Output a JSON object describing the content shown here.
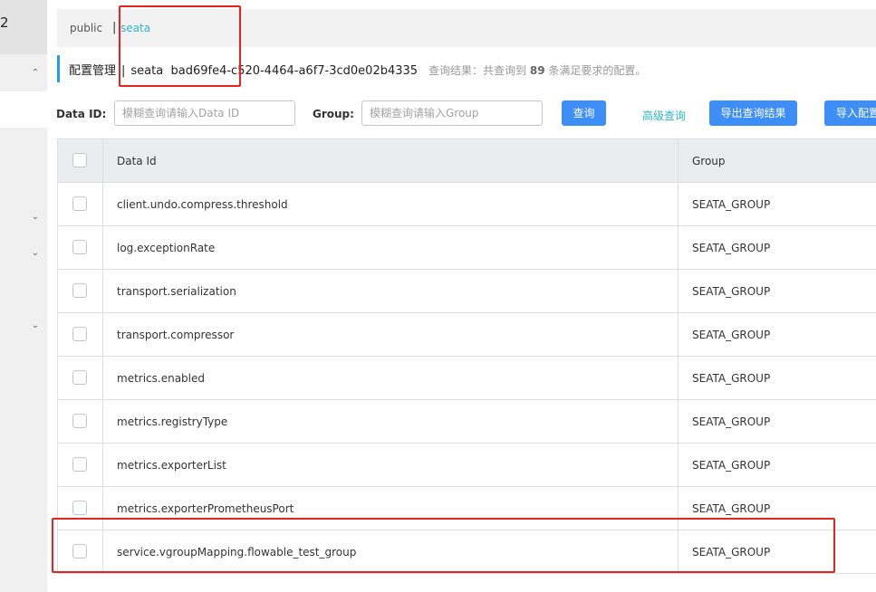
{
  "sidebar": {
    "top_label": "2",
    "icons": [
      "chevron-up-icon",
      "chevron-down-icon",
      "chevron-down-icon",
      "chevron-down-icon"
    ]
  },
  "namespaces": {
    "items": [
      "public",
      "seata"
    ],
    "separator": "|",
    "active": "seata"
  },
  "header": {
    "title": "配置管理",
    "separator": "|",
    "namespace": "seata",
    "namespace_id": "bad69fe4-c520-4464-a6f7-3cd0e02b4335",
    "result_prefix": "查询结果：共查询到",
    "result_count": "89",
    "result_suffix": "条满足要求的配置。"
  },
  "search": {
    "data_id_label": "Data ID:",
    "data_id_placeholder": "模糊查询请输入Data ID",
    "group_label": "Group:",
    "group_placeholder": "模糊查询请输入Group",
    "query_button": "查询",
    "advanced_link": "高级查询",
    "export_button": "导出查询结果",
    "import_button": "导入配置"
  },
  "table": {
    "columns": [
      "Data Id",
      "Group"
    ],
    "rows": [
      {
        "data_id": "client.undo.compress.threshold",
        "group": "SEATA_GROUP"
      },
      {
        "data_id": "log.exceptionRate",
        "group": "SEATA_GROUP"
      },
      {
        "data_id": "transport.serialization",
        "group": "SEATA_GROUP"
      },
      {
        "data_id": "transport.compressor",
        "group": "SEATA_GROUP"
      },
      {
        "data_id": "metrics.enabled",
        "group": "SEATA_GROUP"
      },
      {
        "data_id": "metrics.registryType",
        "group": "SEATA_GROUP"
      },
      {
        "data_id": "metrics.exporterList",
        "group": "SEATA_GROUP"
      },
      {
        "data_id": "metrics.exporterPrometheusPort",
        "group": "SEATA_GROUP"
      },
      {
        "data_id": "service.vgroupMapping.flowable_test_group",
        "group": "SEATA_GROUP"
      }
    ]
  },
  "colors": {
    "accent": "#3e8ef7",
    "link": "#2bb6c8",
    "highlight": "#e8231f",
    "title_bar": "#209bfa"
  }
}
